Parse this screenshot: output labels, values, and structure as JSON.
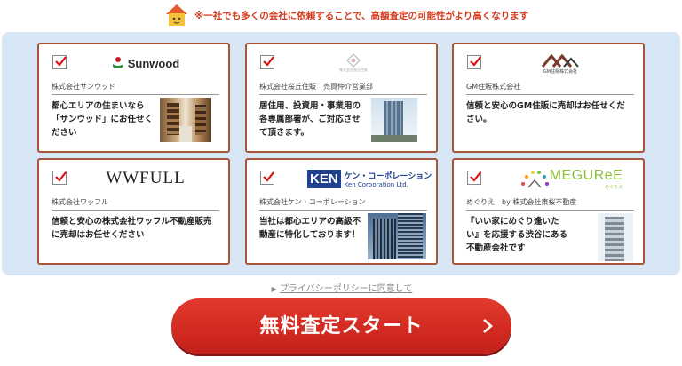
{
  "notice": {
    "text": "※一社でも多くの会社に依頼することで、高額査定の可能性がより高くなります"
  },
  "companies": [
    {
      "logo_text": "Sunwood",
      "name": "株式会社サンウッド",
      "description": "都心エリアの住まいなら\n「サンウッド」にお任せく\nださい",
      "checked": true
    },
    {
      "logo_text": "株式会社桜丘住販",
      "name": "株式会社桜丘住販　売買仲介営業部",
      "description": "居住用、投資用・事業用の\n各専属部署が、ご対応させ\nて頂きます。",
      "checked": true
    },
    {
      "logo_text": "GM住販株式会社",
      "name": "GM住販株式会社",
      "description": "信頼と安心のGM住販に売却はお任せくだ\nさい。",
      "checked": true
    },
    {
      "logo_text": "WWFULL",
      "name": "株式会社ワッフル",
      "description": "信頼と安心の株式会社ワッフル不動産販売\nに売却はお任せください",
      "checked": true
    },
    {
      "logo_text_main": "KEN",
      "logo_text_jp": "ケン・コーポレーション",
      "logo_text_en": "Ken Corporation Ltd.",
      "name": "株式会社ケン・コーポレーション",
      "description": "当社は都心エリアの高級不\n動産に特化しております！",
      "checked": true
    },
    {
      "logo_text": "MEGUReE",
      "logo_sub": "めぐりえ",
      "name": "めぐりえ　by 株式会社東桜不動産",
      "description": "『いい家にめぐり逢いた\nい』を応援する渋谷にある\n不動産会社です",
      "checked": true
    }
  ],
  "privacy": {
    "arrow": "▶",
    "text": "プライバシーポリシーに同意して"
  },
  "start_button": {
    "label": "無料査定スタート"
  },
  "colors": {
    "accent": "#c41f1a",
    "border": "#a8553a",
    "panel": "#d7e6f4",
    "notice": "#d53a1e"
  }
}
